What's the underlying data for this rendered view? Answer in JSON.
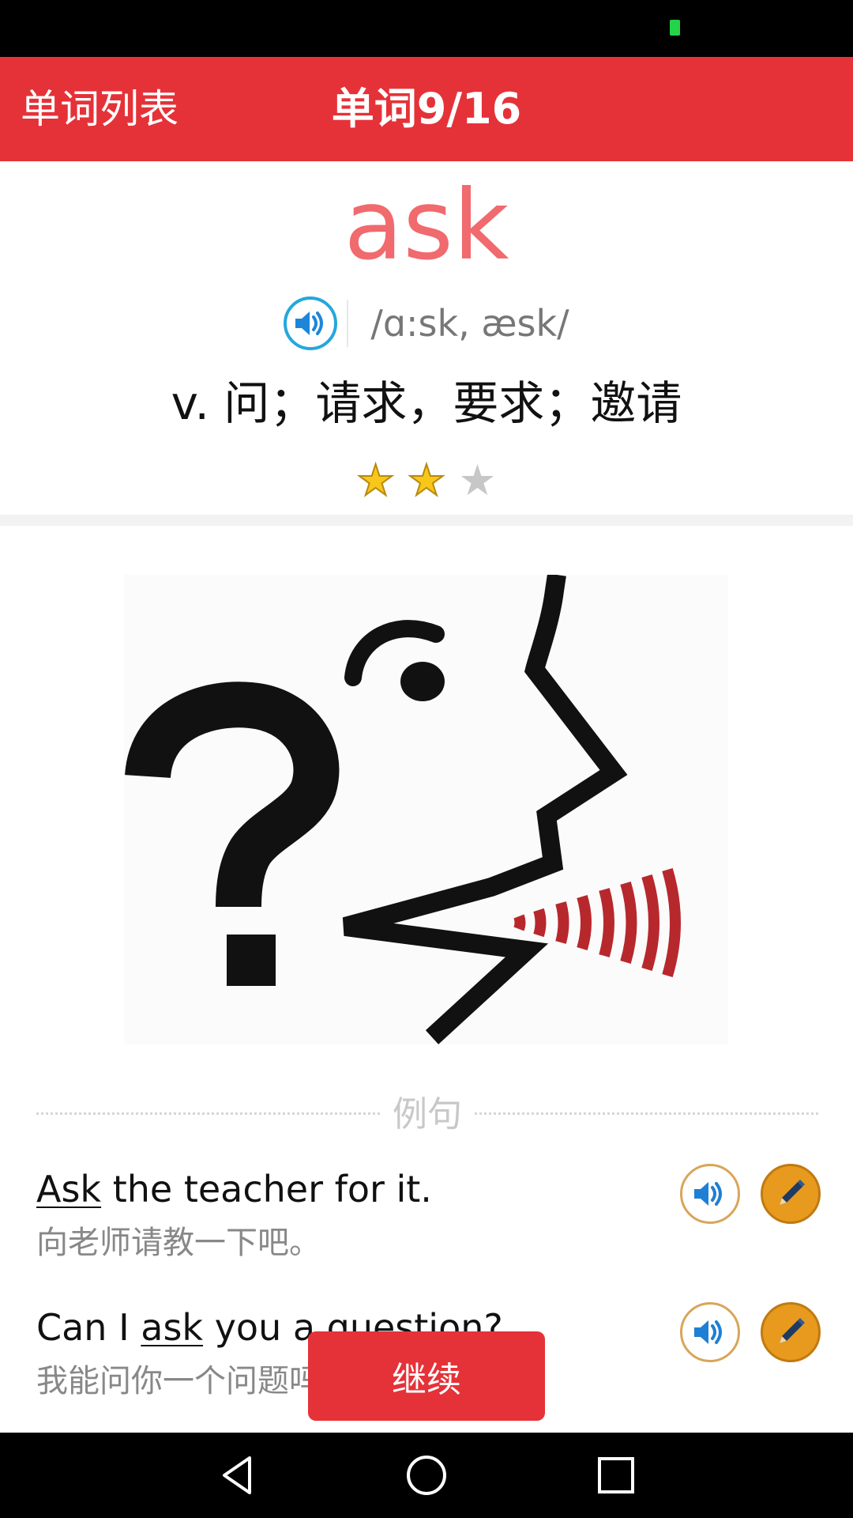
{
  "header": {
    "back_label": "单词列表",
    "title": "单词9/16",
    "color": "#e53238"
  },
  "word": {
    "text": "ask",
    "phonetic": "/ɑ:sk, æsk/",
    "meaning": "v. 问；请求，要求；邀请",
    "stars": {
      "filled": 2,
      "total": 3
    },
    "speaker_icon": "speaker-icon"
  },
  "illustration": {
    "icon": "person-asking-question-illustration"
  },
  "examples_section": {
    "title": "例句",
    "items": [
      {
        "before": "",
        "keyword": "Ask",
        "after": " the teacher for it.",
        "translation": "向老师请教一下吧。",
        "audio_icon": "speaker-icon",
        "edit_icon": "pencil-icon"
      },
      {
        "before": "Can I ",
        "keyword": "ask",
        "after": " you a question?",
        "translation": "我能问你一个问题吗？",
        "audio_icon": "speaker-icon",
        "edit_icon": "pencil-icon"
      }
    ]
  },
  "continue_button": {
    "label": "继续"
  },
  "navigation": {
    "back_icon": "back-triangle-icon",
    "home_icon": "home-circle-icon",
    "recents_icon": "recents-square-icon"
  }
}
